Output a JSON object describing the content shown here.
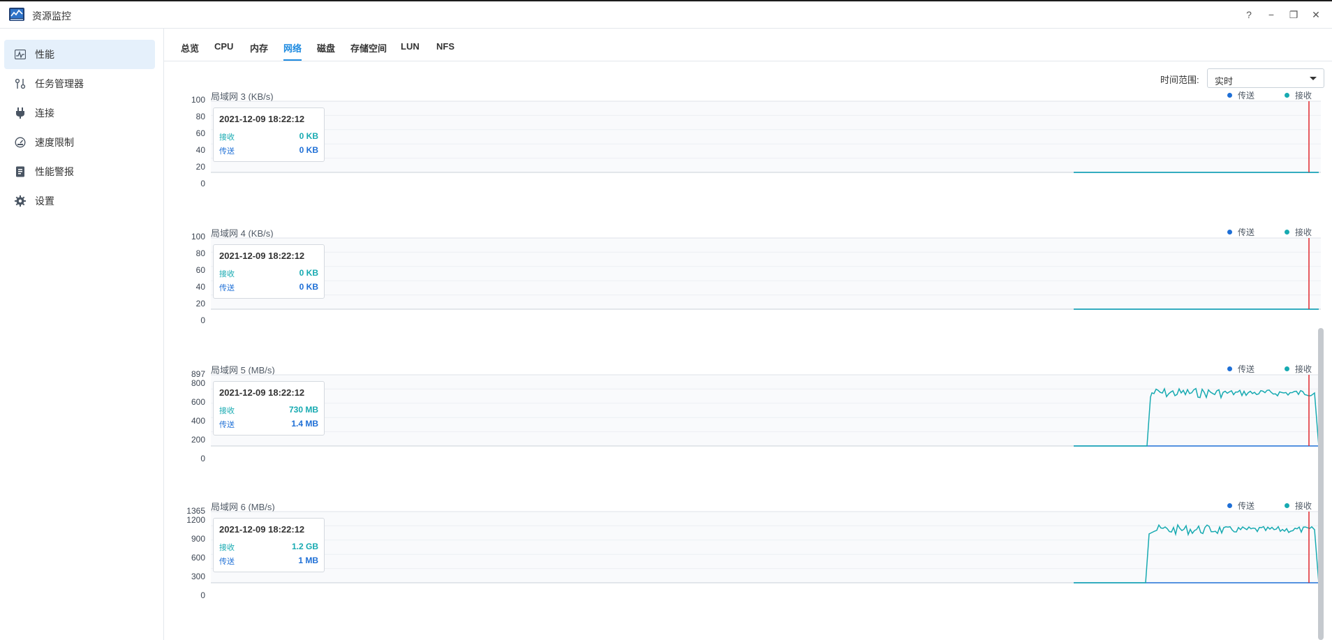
{
  "app": {
    "title": "资源监控"
  },
  "window_buttons": {
    "help": "?",
    "minimize": "−",
    "restore": "❐",
    "close": "✕"
  },
  "sidebar": {
    "items": [
      {
        "label": "性能",
        "icon": "performance-icon"
      },
      {
        "label": "任务管理器",
        "icon": "task-manager-icon"
      },
      {
        "label": "连接",
        "icon": "plug-icon"
      },
      {
        "label": "速度限制",
        "icon": "speed-limit-icon"
      },
      {
        "label": "性能警报",
        "icon": "alert-report-icon"
      },
      {
        "label": "设置",
        "icon": "gear-icon"
      }
    ]
  },
  "tabs": [
    {
      "label": "总览"
    },
    {
      "label": "CPU"
    },
    {
      "label": "内存"
    },
    {
      "label": "网络",
      "active": true
    },
    {
      "label": "磁盘"
    },
    {
      "label": "存储空间"
    },
    {
      "label": "LUN"
    },
    {
      "label": "NFS"
    }
  ],
  "time_range": {
    "label": "时间范围:",
    "value": "实时"
  },
  "legend": {
    "send": "传送",
    "receive": "接收"
  },
  "colors": {
    "send": "#1e6fd6",
    "receive": "#17aab1",
    "cursor": "#e0262c",
    "tab_active": "#1e8be0"
  },
  "charts": [
    {
      "title": "局域网 3 (KB/s)",
      "yticks": [
        "100",
        "80",
        "60",
        "40",
        "20",
        "0"
      ],
      "tooltip": {
        "time": "2021-12-09 18:22:12",
        "recv_label": "接收",
        "recv_value": "0 KB",
        "send_label": "传送",
        "send_value": "0 KB"
      }
    },
    {
      "title": "局域网 4 (KB/s)",
      "yticks": [
        "100",
        "80",
        "60",
        "40",
        "20",
        "0"
      ],
      "tooltip": {
        "time": "2021-12-09 18:22:12",
        "recv_label": "接收",
        "recv_value": "0 KB",
        "send_label": "传送",
        "send_value": "0 KB"
      }
    },
    {
      "title": "局域网 5 (MB/s)",
      "max_label": "897",
      "yticks": [
        "800",
        "600",
        "400",
        "200",
        "0"
      ],
      "tooltip": {
        "time": "2021-12-09 18:22:12",
        "recv_label": "接收",
        "recv_value": "730 MB",
        "send_label": "传送",
        "send_value": "1.4 MB"
      }
    },
    {
      "title": "局域网 6 (MB/s)",
      "max_label": "1365",
      "yticks": [
        "1200",
        "900",
        "600",
        "300",
        "0"
      ],
      "tooltip": {
        "time": "2021-12-09 18:22:12",
        "recv_label": "接收",
        "recv_value": "1.2 GB",
        "send_label": "传送",
        "send_value": "1 MB"
      }
    }
  ]
}
